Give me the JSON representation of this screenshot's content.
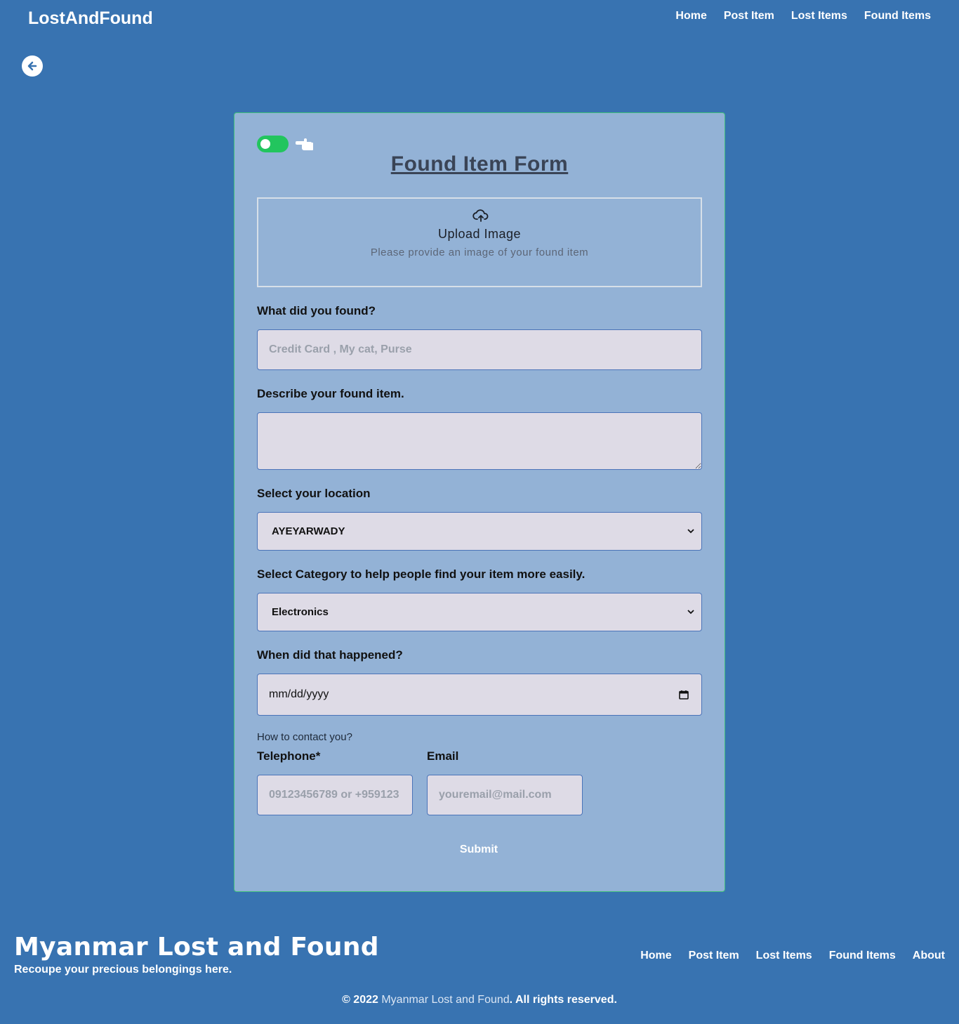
{
  "navbar": {
    "brand": "LostAndFound",
    "links": [
      "Home",
      "Post Item",
      "Lost Items",
      "Found Items"
    ]
  },
  "form": {
    "title": "Found Item Form",
    "upload": {
      "title": "Upload Image",
      "subtitle": "Please provide an image of your found item"
    },
    "what_label": "What did you found?",
    "what_placeholder": "Credit Card , My cat, Purse",
    "describe_label": "Describe your found item.",
    "location_label": "Select your location",
    "location_value": "AYEYARWADY",
    "category_label": "Select Category to help people find your item more easily.",
    "category_value": "Electronics",
    "when_label": "When did that happened?",
    "date_value": "mm/dd/yyyy",
    "contact_question": "How to contact you?",
    "telephone_label": "Telephone*",
    "telephone_placeholder": "09123456789 or +959123",
    "email_label": "Email",
    "email_placeholder": "youremail@mail.com",
    "submit_label": "Submit"
  },
  "footer": {
    "title": "Myanmar Lost and Found",
    "subtitle": "Recoupe your precious belongings here.",
    "links": [
      "Home",
      "Post Item",
      "Lost Items",
      "Found Items",
      "About"
    ],
    "copyright_prefix": "© 2022 ",
    "copyright_brand": "Myanmar Lost and Found",
    "copyright_suffix": ". All rights reserved."
  },
  "colors": {
    "background": "#3873b1",
    "card": "#93b2d6",
    "toggle_on": "#22c55e",
    "input_bg": "#dedbe6"
  },
  "toggle": {
    "on": true
  }
}
